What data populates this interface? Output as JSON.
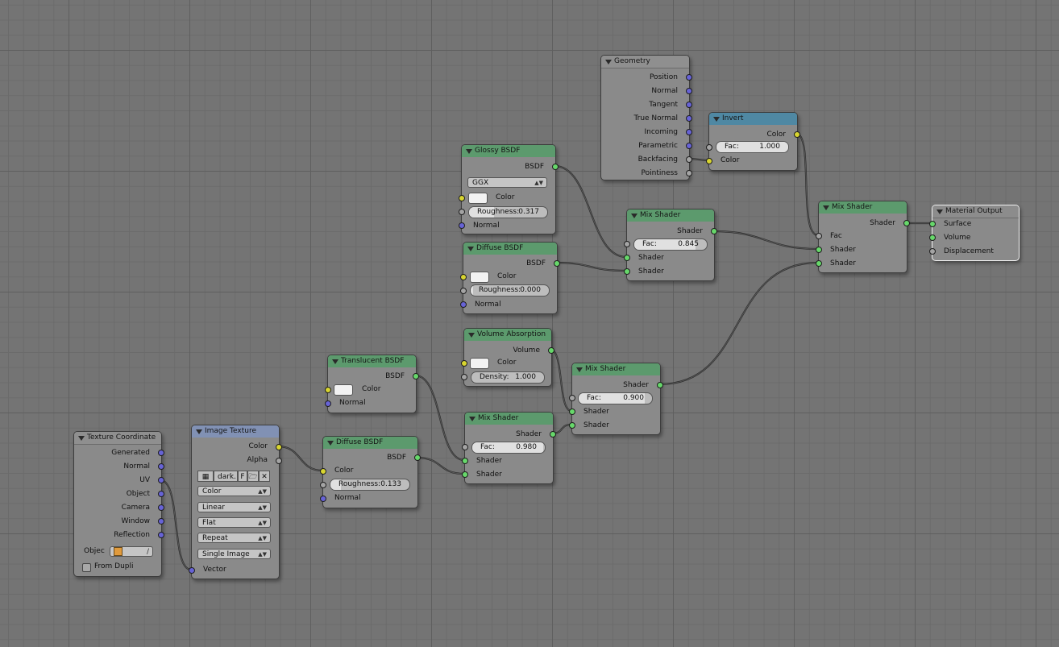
{
  "nodes": {
    "geometry": {
      "title": "Geometry",
      "outputs": [
        "Position",
        "Normal",
        "Tangent",
        "True Normal",
        "Incoming",
        "Parametric",
        "Backfacing",
        "Pointiness"
      ]
    },
    "invert": {
      "title": "Invert",
      "output": "Color",
      "fac_label": "Fac:",
      "fac_value": "1.000",
      "input_color": "Color"
    },
    "glossy": {
      "title": "Glossy BSDF",
      "output": "BSDF",
      "distribution": "GGX",
      "color_label": "Color",
      "roughness_label": "Roughness:",
      "roughness_value": "0.317",
      "normal_label": "Normal"
    },
    "diffuse1": {
      "title": "Diffuse BSDF",
      "output": "BSDF",
      "color_label": "Color",
      "roughness_label": "Roughness:",
      "roughness_value": "0.000",
      "normal_label": "Normal"
    },
    "mix1": {
      "title": "Mix Shader",
      "output": "Shader",
      "fac_label": "Fac:",
      "fac_value": "0.845",
      "in1": "Shader",
      "in2": "Shader"
    },
    "mix_main": {
      "title": "Mix Shader",
      "output": "Shader",
      "fac_label": "Fac",
      "in1": "Shader",
      "in2": "Shader"
    },
    "output": {
      "title": "Material Output",
      "inputs": [
        "Surface",
        "Volume",
        "Displacement"
      ]
    },
    "volume": {
      "title": "Volume Absorption",
      "output": "Volume",
      "color_label": "Color",
      "density_label": "Density:",
      "density_value": "1.000"
    },
    "translucent": {
      "title": "Translucent BSDF",
      "output": "BSDF",
      "color_label": "Color",
      "normal_label": "Normal"
    },
    "mix2": {
      "title": "Mix Shader",
      "output": "Shader",
      "fac_label": "Fac:",
      "fac_value": "0.900",
      "in1": "Shader",
      "in2": "Shader"
    },
    "mix3": {
      "title": "Mix Shader",
      "output": "Shader",
      "fac_label": "Fac:",
      "fac_value": "0.980",
      "in1": "Shader",
      "in2": "Shader"
    },
    "diffuse2": {
      "title": "Diffuse BSDF",
      "output": "BSDF",
      "color_label": "Color",
      "roughness_label": "Roughness:",
      "roughness_value": "0.133",
      "normal_label": "Normal"
    },
    "texcoord": {
      "title": "Texture Coordinate",
      "outputs": [
        "Generated",
        "Normal",
        "UV",
        "Object",
        "Camera",
        "Window",
        "Reflection"
      ],
      "object_label": "Objec",
      "from_dupli_label": "From Dupli"
    },
    "imagetex": {
      "title": "Image Texture",
      "out_color": "Color",
      "out_alpha": "Alpha",
      "image_name": "dark.",
      "fake_user": "F",
      "color_space": "Color",
      "interpolation": "Linear",
      "projection": "Flat",
      "extension": "Repeat",
      "source": "Single Image",
      "vector_label": "Vector"
    }
  },
  "colors": {
    "shader_socket": "#67d86b",
    "color_socket": "#d8d530",
    "vector_socket": "#6763d6",
    "value_socket": "#a4a4a4",
    "link": "#202020"
  }
}
